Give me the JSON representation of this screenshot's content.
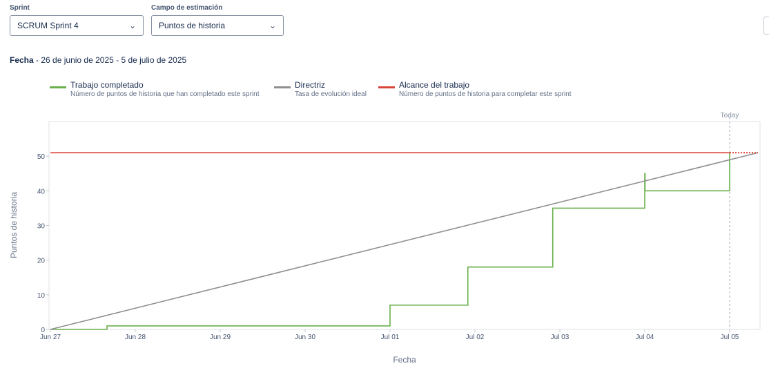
{
  "filters": {
    "sprint_label": "Sprint",
    "sprint_value": "SCRUM Sprint 4",
    "estimation_label": "Campo de estimación",
    "estimation_value": "Puntos de historia"
  },
  "date_range": {
    "label": "Fecha",
    "separator": " - ",
    "value": "26 de junio de 2025 - 5 de julio de 2025"
  },
  "legend": [
    {
      "title": "Trabajo completado",
      "description": "Número de puntos de historia que han completado este sprint",
      "color": "#6ab04c"
    },
    {
      "title": "Directriz",
      "description": "Tasa de evolución ideal",
      "color": "#8f8f8f"
    },
    {
      "title": "Alcance del trabajo",
      "description": "Número de puntos de historia para completar este sprint",
      "color": "#d9453b"
    }
  ],
  "chart_data": {
    "type": "line",
    "xlabel": "Fecha",
    "ylabel": "Puntos de historia",
    "x_ticks": [
      "Jun 27",
      "Jun 28",
      "Jun 29",
      "Jun 30",
      "Jul 01",
      "Jul 02",
      "Jul 03",
      "Jul 04",
      "Jul 05"
    ],
    "y_ticks": [
      0,
      10,
      20,
      30,
      40,
      50
    ],
    "xlim": [
      "2025-06-27",
      "2025-07-05"
    ],
    "ylim": [
      0,
      60
    ],
    "today_label": "Today",
    "today": "2025-07-05",
    "series": [
      {
        "name": "Trabajo completado",
        "color": "#6ab04c",
        "step": true,
        "points": [
          [
            "2025-06-27",
            0
          ],
          [
            "2025-06-27 16:00",
            1
          ],
          [
            "2025-07-01",
            7
          ],
          [
            "2025-07-01 22:00",
            18
          ],
          [
            "2025-07-02 22:00",
            35
          ],
          [
            "2025-07-04",
            45
          ],
          [
            "2025-07-04 00:05",
            40
          ],
          [
            "2025-07-05",
            51
          ]
        ]
      },
      {
        "name": "Directriz",
        "color": "#8f8f8f",
        "step": false,
        "points": [
          [
            "2025-06-27",
            0
          ],
          [
            "2025-07-05 08:00",
            51
          ]
        ]
      },
      {
        "name": "Alcance del trabajo",
        "color": "#d9453b",
        "step": false,
        "points": [
          [
            "2025-06-27",
            51
          ],
          [
            "2025-07-05",
            51
          ]
        ],
        "projection": [
          [
            "2025-07-05",
            51
          ],
          [
            "2025-07-05 08:00",
            51
          ]
        ]
      }
    ]
  }
}
